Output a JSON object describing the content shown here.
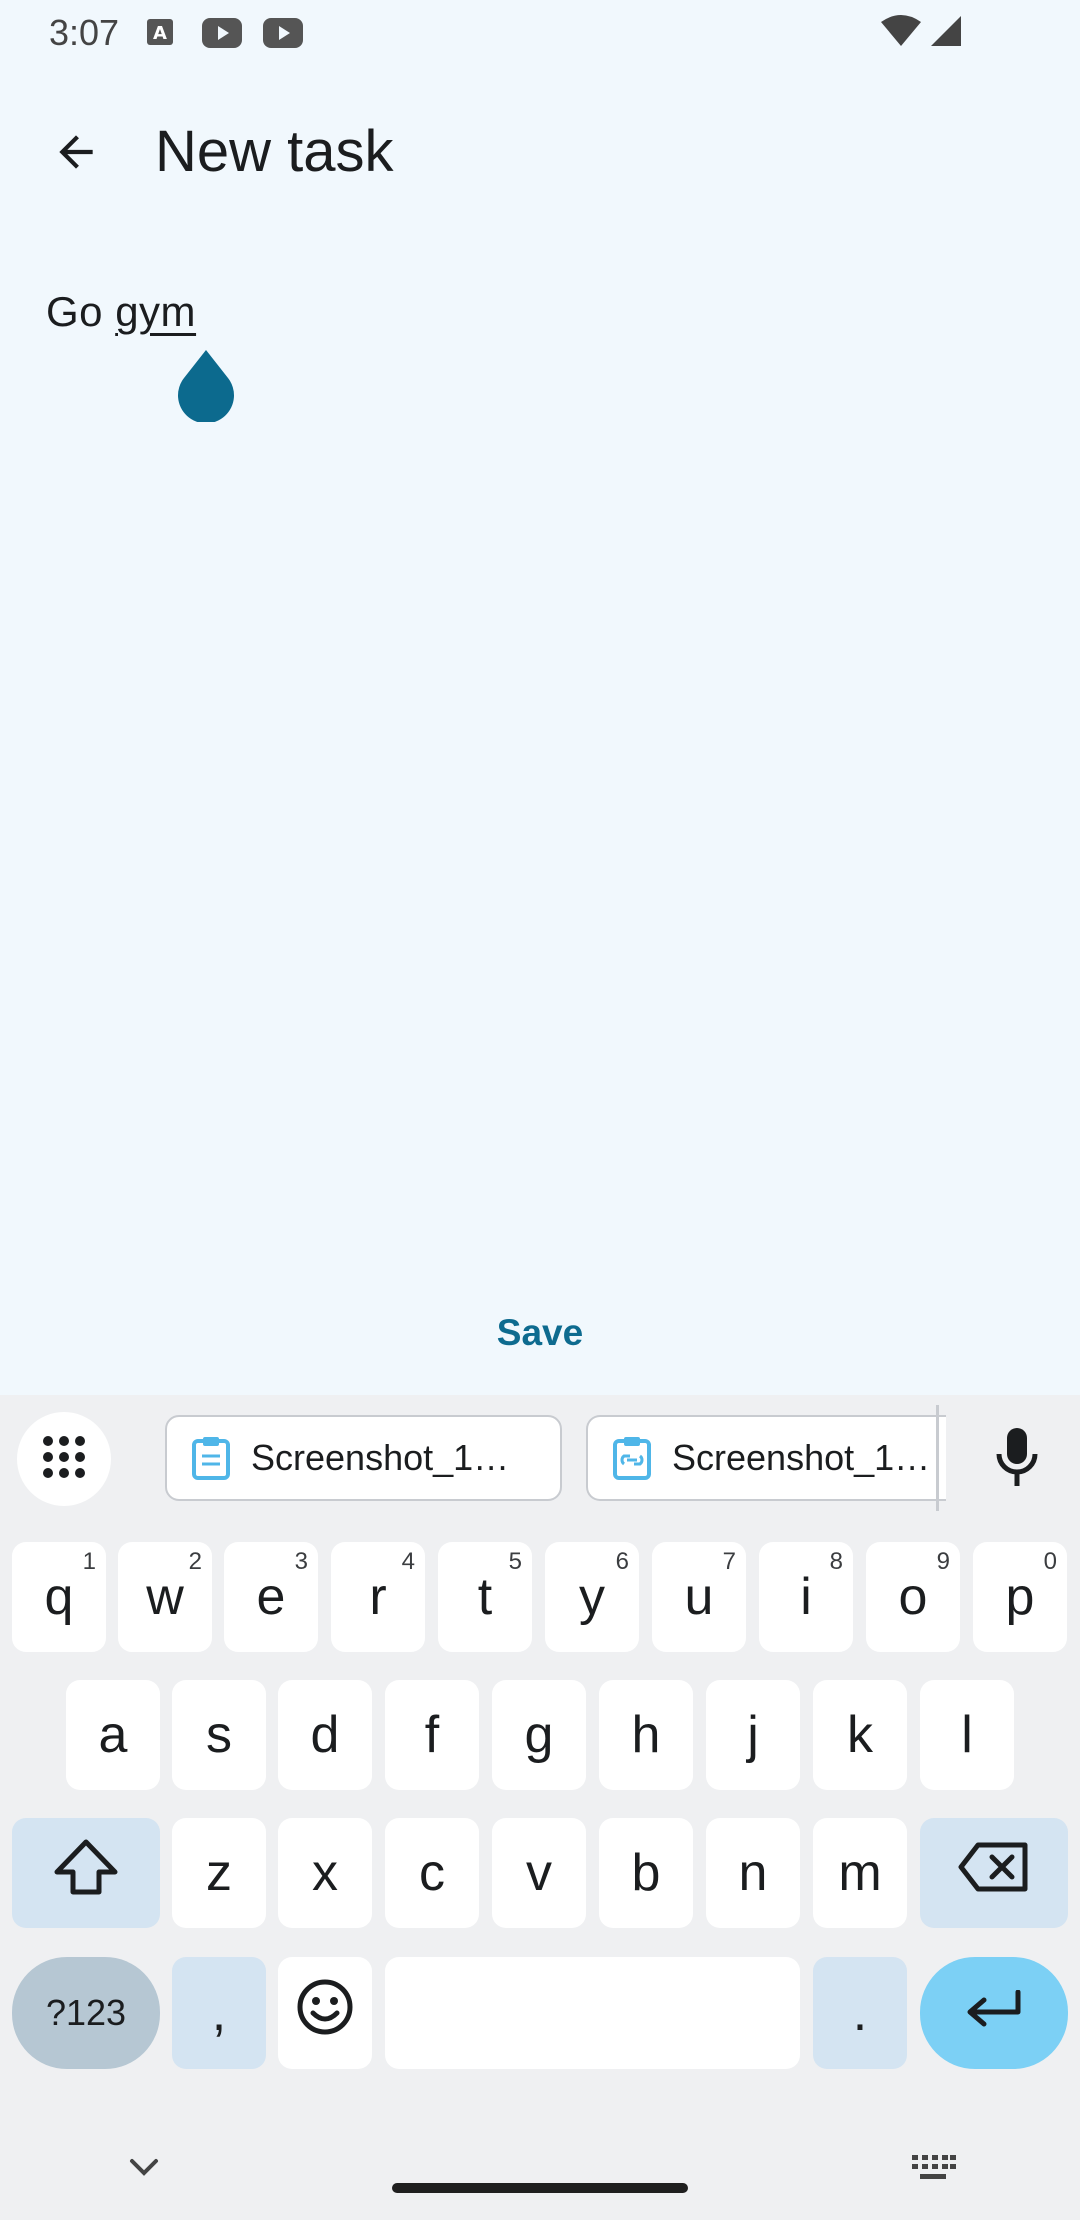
{
  "status_bar": {
    "time": "3:07",
    "icons": [
      "translate-icon",
      "youtube-icon",
      "youtube-icon",
      "wifi-icon",
      "signal-icon"
    ]
  },
  "app_bar": {
    "title": "New task",
    "back_icon": "arrow-back-icon"
  },
  "editor": {
    "text_plain": "Go ",
    "text_underlined": "gym"
  },
  "actions": {
    "save_label": "Save"
  },
  "keyboard": {
    "clipboard": [
      {
        "label": "Screenshot_1…",
        "icon": "clipboard-icon"
      },
      {
        "label": "Screenshot_1…",
        "icon": "clipboard-link-icon"
      }
    ],
    "row1": [
      {
        "key": "q",
        "hint": "1"
      },
      {
        "key": "w",
        "hint": "2"
      },
      {
        "key": "e",
        "hint": "3"
      },
      {
        "key": "r",
        "hint": "4"
      },
      {
        "key": "t",
        "hint": "5"
      },
      {
        "key": "y",
        "hint": "6"
      },
      {
        "key": "u",
        "hint": "7"
      },
      {
        "key": "i",
        "hint": "8"
      },
      {
        "key": "o",
        "hint": "9"
      },
      {
        "key": "p",
        "hint": "0"
      }
    ],
    "row2": [
      "a",
      "s",
      "d",
      "f",
      "g",
      "h",
      "j",
      "k",
      "l"
    ],
    "row3": [
      "z",
      "x",
      "c",
      "v",
      "b",
      "n",
      "m"
    ],
    "symbols_label": "?123",
    "comma": ",",
    "period": "."
  },
  "colors": {
    "background": "#f1f8fd",
    "accent": "#0e6b8f",
    "keyboard_bg": "#eff0f2",
    "enter_key": "#7cd0f5"
  }
}
